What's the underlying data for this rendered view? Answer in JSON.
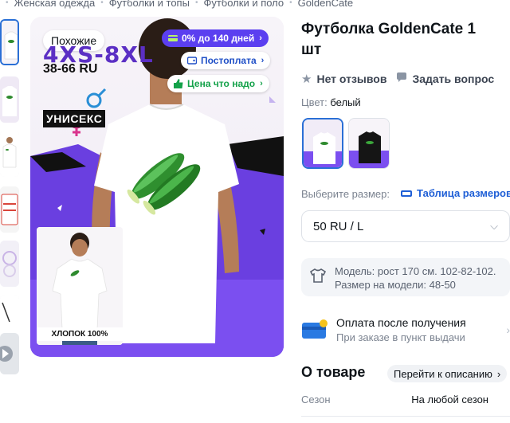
{
  "breadcrumb": [
    "Женская одежда",
    "Футболки и топы",
    "Футболки и поло",
    "GoldenCate"
  ],
  "gallery": {
    "badge_similar": "Похожие",
    "promo_size": "4XS-8XL",
    "promo_size_ru": "38-66 RU",
    "promo_unisex": "УНИСЕКС",
    "promo_material": "ХЛОПОК 100%",
    "pills": {
      "installment": "0% до 140 дней",
      "postpay": "Постоплата",
      "fair_price": "Цена что надо"
    }
  },
  "product": {
    "title_line1": "Футболка GoldenCate 1",
    "title_line2": "шт",
    "reviews": "Нет отзывов",
    "ask": "Задать вопрос",
    "color_label": "Цвет:",
    "color_value": "белый",
    "size_label": "Выберите размер:",
    "size_table": "Таблица размеров",
    "size_selected": "50 RU / L",
    "model_line1": "Модель: рост 170 см. 102-82-102.",
    "model_line2": "Размер на модели: 48-50",
    "payment_title": "Оплата после получения",
    "payment_sub": "При заказе в пункт выдачи",
    "about_title": "О товаре",
    "about_link": "Перейти к описанию",
    "season_key": "Сезон",
    "season_value": "На любой сезон"
  },
  "colors": {
    "accent_blue": "#2a6fd6",
    "purple": "#5b3ff0",
    "green": "#14a24a"
  }
}
